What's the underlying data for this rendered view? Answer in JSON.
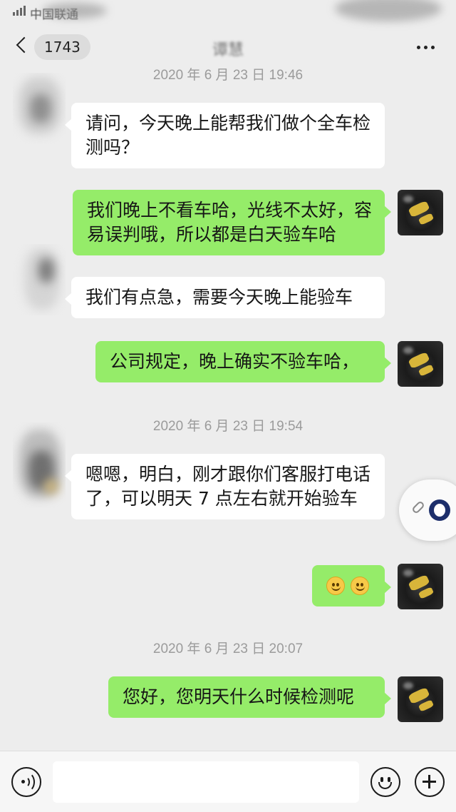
{
  "status_bar": {
    "carrier": "中国联通"
  },
  "nav": {
    "unread_count": "1743",
    "title": "谭慧"
  },
  "chat": {
    "messages": [
      {
        "type": "timestamp",
        "text": "2020 年 6 月 23 日 19:46"
      },
      {
        "type": "incoming",
        "text": "请问，今天晚上能帮我们做个全车检测吗？"
      },
      {
        "type": "outgoing",
        "text": "我们晚上不看车哈，光线不太好，容易误判哦，所以都是白天验车哈"
      },
      {
        "type": "incoming",
        "text": "我们有点急，需要今天晚上能验车"
      },
      {
        "type": "outgoing",
        "text": "公司规定，晚上确实不验车哈，"
      },
      {
        "type": "timestamp",
        "text": "2020 年 6 月 23 日 19:54"
      },
      {
        "type": "incoming",
        "text": "嗯嗯，明白，刚才跟你们客服打电话了，可以明天 7 点左右就开始验车"
      },
      {
        "type": "outgoing",
        "emoji": [
          "smiling-face-icon",
          "smiling-face-icon"
        ]
      },
      {
        "type": "timestamp",
        "text": "2020 年 6 月 23 日 20:07"
      },
      {
        "type": "outgoing",
        "text": "您好，您明天什么时候检测呢"
      }
    ]
  },
  "input_bar": {
    "placeholder": ""
  },
  "colors": {
    "background": "#ededed",
    "outgoing_bubble": "#95ec69",
    "incoming_bubble": "#ffffff"
  }
}
